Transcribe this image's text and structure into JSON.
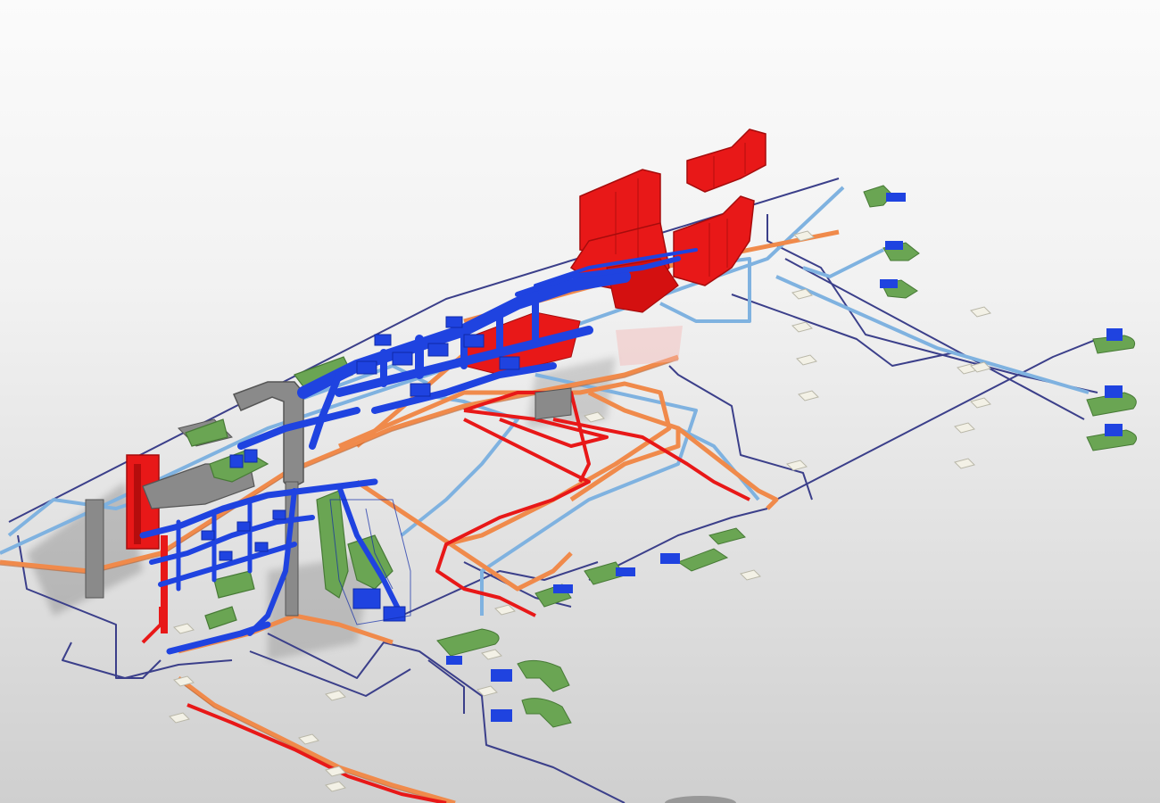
{
  "view": {
    "type": "3D isometric MEP model view",
    "background": [
      "#fbfbfb",
      "#cfcfcf"
    ]
  },
  "systems": [
    {
      "key": "supply_air",
      "color": "#1f43e0",
      "shade": "#0f2aa8"
    },
    {
      "key": "hot_pipe",
      "color": "#e81818",
      "shade": "#a60c0c"
    },
    {
      "key": "return_pipe",
      "color": "#f08a4b",
      "shade": "#b85d2a"
    },
    {
      "key": "chilled_pipe",
      "color": "#7fb2e0",
      "shade": "#3f7fbf"
    },
    {
      "key": "drain",
      "color": "#6aa553",
      "shade": "#477a36"
    },
    {
      "key": "equipment",
      "color": "#8a8a8a",
      "shade": "#555555"
    },
    {
      "key": "cable_tray",
      "color": "#3b3f8a",
      "shade": "#1e2155"
    },
    {
      "key": "diffuser",
      "color": "#f3f1e6",
      "shade": "#b9b7a8"
    }
  ]
}
